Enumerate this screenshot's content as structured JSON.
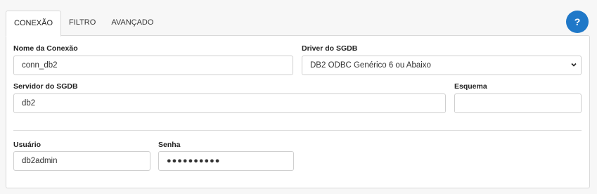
{
  "tabs": [
    {
      "label": "CONEXÃO",
      "active": true
    },
    {
      "label": "FILTRO",
      "active": false
    },
    {
      "label": "AVANÇADO",
      "active": false
    }
  ],
  "help": {
    "label": "?",
    "icon": "help-icon",
    "color": "#1f78c8"
  },
  "form": {
    "connection_name": {
      "label": "Nome da Conexão",
      "value": "conn_db2"
    },
    "driver": {
      "label": "Driver do SGDB",
      "value": "DB2 ODBC Genérico 6 ou Abaixo"
    },
    "server": {
      "label": "Servidor do SGDB",
      "value": "db2"
    },
    "schema": {
      "label": "Esquema",
      "value": ""
    },
    "user": {
      "label": "Usuário",
      "value": "db2admin"
    },
    "password": {
      "label": "Senha",
      "value": "●●●●●●●●●●"
    }
  }
}
